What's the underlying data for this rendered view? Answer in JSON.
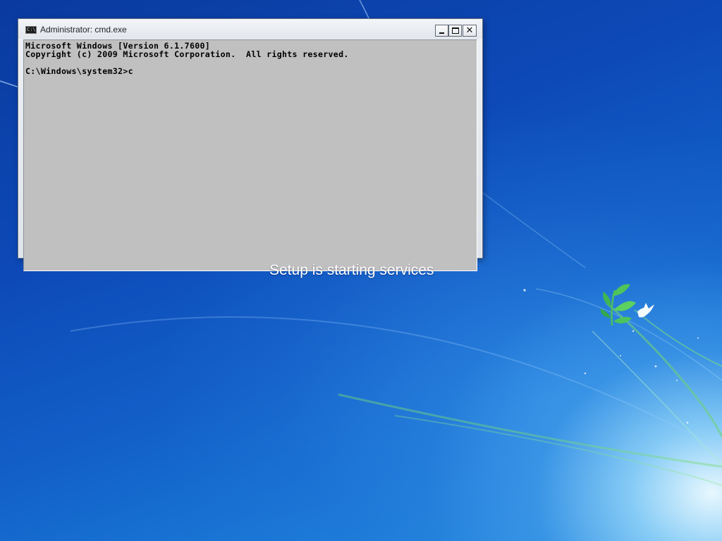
{
  "window": {
    "title": "Administrator: cmd.exe",
    "icon": "cmd-icon",
    "icon_text": "C:\\",
    "controls": {
      "minimize": "minimize-icon",
      "maximize": "maximize-icon",
      "close": "close-icon"
    }
  },
  "console": {
    "lines": [
      "Microsoft Windows [Version 6.1.7600]",
      "Copyright (c) 2009 Microsoft Corporation.  All rights reserved.",
      "",
      "C:\\Windows\\system32>c"
    ],
    "background": "#c0c0c0",
    "foreground": "#000000"
  },
  "status": {
    "text": "Setup is starting services"
  },
  "desktop": {
    "wallpaper": "windows-7-logo-icon",
    "accent": "#0d4ab8"
  }
}
